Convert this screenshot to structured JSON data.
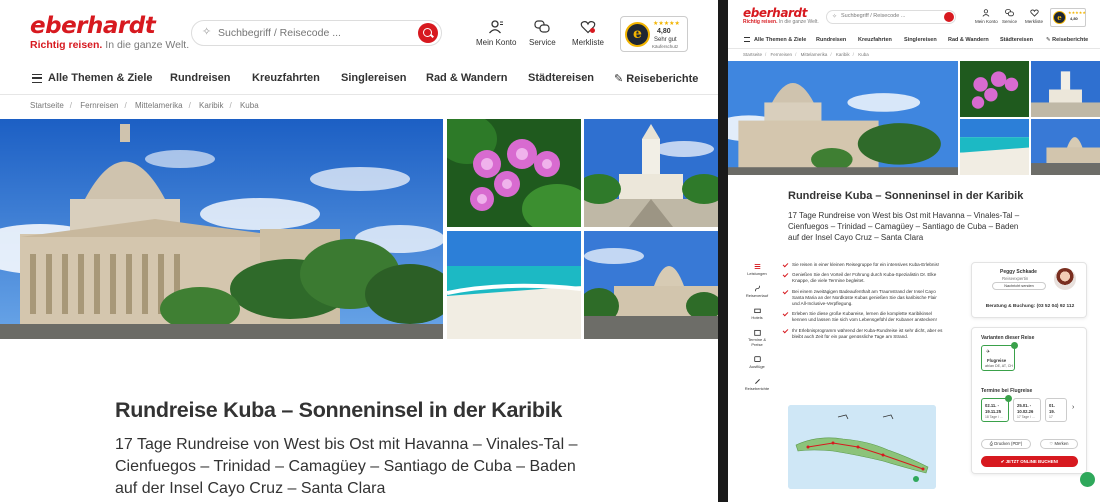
{
  "brand": {
    "name": "eberhardt",
    "tagline_bold": "Richtig reisen.",
    "tagline_rest": " In die ganze Welt.",
    "color": "#d7191f"
  },
  "search": {
    "placeholder": "Suchbegriff / Reisecode ..."
  },
  "header_icons": [
    {
      "label": "Mein Konto",
      "icon": "user-icon"
    },
    {
      "label": "Service",
      "icon": "chat-icon"
    },
    {
      "label": "Merkliste",
      "icon": "heart-icon"
    }
  ],
  "trust_badge": {
    "seal": "e",
    "stars": "★★★★★",
    "score": "4,80",
    "grade": "Sehr gut",
    "sub": "Käuferschutz"
  },
  "nav": {
    "menu_label": "Alle Themen & Ziele",
    "items": [
      "Rundreisen",
      "Kreuzfahrten",
      "Singlereisen",
      "Rad & Wandern",
      "Städtereisen"
    ],
    "reports": "Reiseberichte"
  },
  "breadcrumb": [
    "Startseite",
    "Fernreisen",
    "Mittelamerika",
    "Karibik",
    "Kuba"
  ],
  "trip": {
    "title": "Rundreise Kuba – Sonneninsel in der Karibik",
    "subtitle": "17 Tage Rundreise von West bis Ost mit Havanna – Vinales-Tal – Cienfuegos – Trinidad – Camagüey – Santiago de Cuba – Baden auf der Insel Cayo Cruz – Santa Clara"
  },
  "sidebar": [
    {
      "label": "Leistungen",
      "icon": "list-icon"
    },
    {
      "label": "Reiseverlauf",
      "icon": "route-icon"
    },
    {
      "label": "Hotels",
      "icon": "bed-icon"
    },
    {
      "label": "Termine & Preise",
      "icon": "calendar-icon"
    },
    {
      "label": "Ausflüge",
      "icon": "bus-icon"
    },
    {
      "label": "Reiseberichte",
      "icon": "pen-icon"
    }
  ],
  "highlights": [
    "Sie reisen in einer kleinen Reisegruppe für ein intensives Kuba-Erlebnis!",
    "Genießen Sie den Vorteil der Führung durch Kuba-Spezialistin Dr. Elke Knappe, die viele Termine begleitet.",
    "Bei einem zweitägigen Badeaufenthalt am Traumstrand der Insel Cayo Santa Maria an der Nordküste Kubas genießen Sie das karibische Flair und All-Inclusive-Verpflegung.",
    "Erleben Sie diese große Kubareise, lernen die komplette Karibikinsel kennen und lassen Sie sich vom Lebensgefühl der Kubaner anstecken!",
    "Ihr Erlebnisprogramm während der Kuba-Rundreise ist sehr dicht, aber es bleibt auch Zeit für ein paar genüssliche Tage am Strand."
  ],
  "contact": {
    "name": "Peggy Schkade",
    "role": "Reiseexpertin",
    "message": "Nachricht senden",
    "phone": "Beratung & Buchung: (03 52 04) 92 112"
  },
  "booking": {
    "variants_title": "Varianten dieser Reise",
    "variant": {
      "name": "Flugreise",
      "detail": "ab/an DE, AT, CH"
    },
    "dates_title": "Termine bei Flugreise",
    "dates": [
      {
        "from": "02.11. -",
        "to": "19.11.25",
        "info": "18 Tage / ..."
      },
      {
        "from": "25.01. -",
        "to": "10.02.26",
        "info": "17 Tage / ..."
      },
      {
        "from": "01.",
        "to": "19.",
        "info": "17"
      }
    ],
    "print": "Drucken (PDF)",
    "remember": "Merken",
    "cta": "JETZT ONLINE BUCHEN!"
  }
}
